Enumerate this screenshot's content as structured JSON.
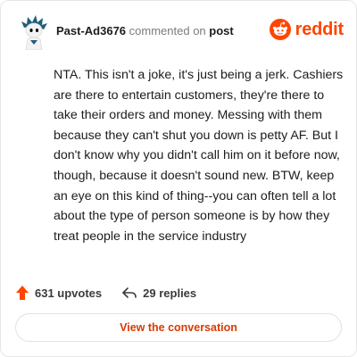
{
  "header": {
    "username": "Past-Ad3676",
    "action_text": "commented on",
    "post_link_text": "post",
    "brand_name": "reddit",
    "brand_icon": "reddit-snoo-icon",
    "avatar_icon": "user-avatar-icon"
  },
  "comment": {
    "body": "NTA. This isn't a joke, it's just being a jerk. Cashiers are there to entertain customers, they're there to take their orders and money. Messing with them because they can't shut you down is petty AF. But I don't know why you didn't call him on it before now, though, because it doesn't sound new. BTW, keep an eye on this kind of thing--you can often tell a lot about the type of person someone is by how they treat people in the service industry"
  },
  "stats": {
    "upvotes_text": "631 upvotes",
    "replies_text": "29 replies",
    "upvote_icon": "upvote-arrow-icon",
    "reply_icon": "reply-arrow-icon"
  },
  "cta": {
    "label": "View the conversation"
  },
  "colors": {
    "brand": "#ff4500",
    "cta_text": "#d93a00",
    "border": "#e6e6e6"
  }
}
